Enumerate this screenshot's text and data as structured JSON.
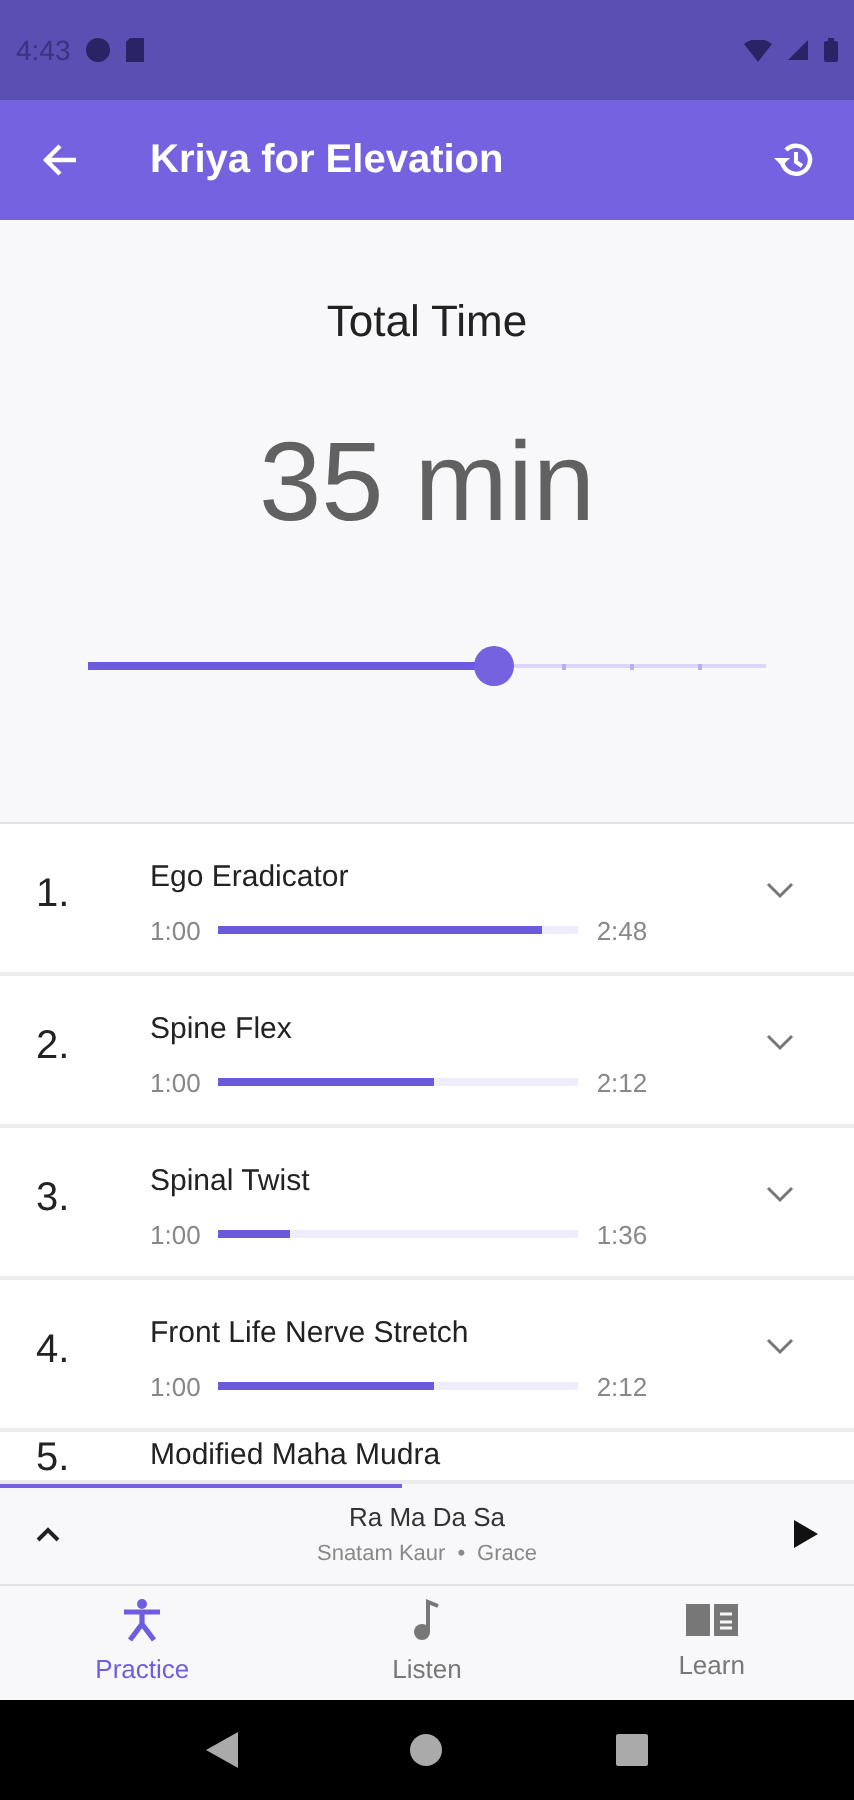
{
  "status_bar": {
    "time": "4:43"
  },
  "app_bar": {
    "title": "Kriya for Elevation"
  },
  "total_time": {
    "label": "Total Time",
    "value": "35 min",
    "level": 0.6
  },
  "exercises": [
    {
      "number": "1.",
      "name": "Ego Eradicator",
      "min": "1:00",
      "max": "2:48",
      "level": 0.9,
      "expanded": false
    },
    {
      "number": "2.",
      "name": "Spine Flex",
      "min": "1:00",
      "max": "2:12",
      "level": 0.6,
      "expanded": false
    },
    {
      "number": "3.",
      "name": "Spinal Twist",
      "min": "1:00",
      "max": "1:36",
      "level": 0.2,
      "expanded": false
    },
    {
      "number": "4.",
      "name": "Front Life Nerve Stretch",
      "min": "1:00",
      "max": "2:12",
      "level": 0.6,
      "expanded": false
    },
    {
      "number": "5.",
      "name": "Modified Maha Mudra"
    }
  ],
  "player": {
    "title": "Ra Ma Da Sa",
    "artist": "Snatam Kaur",
    "separator": "•",
    "album": "Grace",
    "level": 0.47
  },
  "nav": [
    {
      "label": "Practice",
      "kind": "practice",
      "selected": true
    },
    {
      "label": "Listen",
      "kind": "listen",
      "selected": false
    },
    {
      "label": "Learn",
      "kind": "learn",
      "selected": false
    }
  ]
}
